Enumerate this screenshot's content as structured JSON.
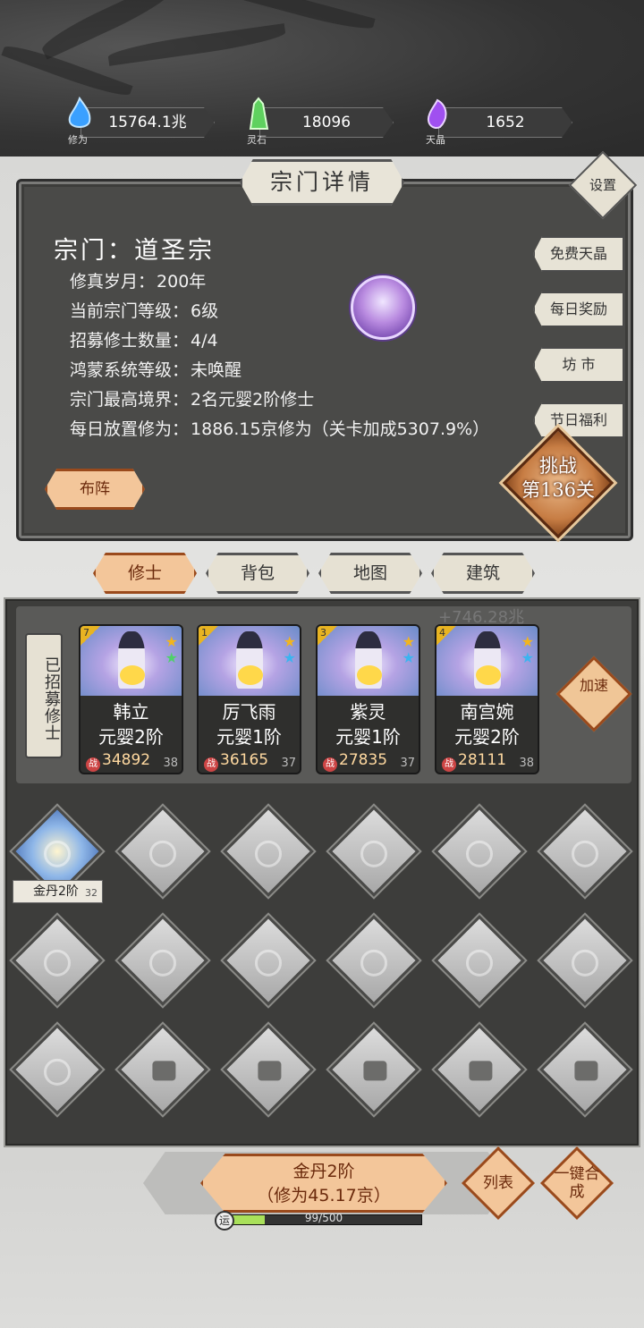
{
  "resources": [
    {
      "name": "修为",
      "value": "15764.1兆",
      "color": "#3aa0ff"
    },
    {
      "name": "灵石",
      "value": "18096",
      "color": "#5fd15f"
    },
    {
      "name": "天晶",
      "value": "1652",
      "color": "#a050f0"
    }
  ],
  "panel": {
    "title": "宗门详情",
    "settings": "设置",
    "sect_name": "宗门：道圣宗",
    "info": [
      {
        "label": "修真岁月：",
        "value": "200年"
      },
      {
        "label": "当前宗门等级：",
        "value": "6级"
      },
      {
        "label": "招募修士数量：",
        "value": "4/4"
      },
      {
        "label": "鸿蒙系统等级：",
        "value": "未唤醒"
      },
      {
        "label": "宗门最高境界：",
        "value": "2名元婴2阶修士"
      },
      {
        "label": "每日放置修为：",
        "value": "1886.15京修为（关卡加成5307.9%）"
      }
    ],
    "side_buttons": [
      "免费天晶",
      "每日奖励",
      "坊 市",
      "节日福利"
    ],
    "formation": "布阵",
    "challenge_line1": "挑战",
    "challenge_line2": "第136关"
  },
  "tabs": [
    {
      "label": "修士",
      "active": true
    },
    {
      "label": "背包",
      "active": false
    },
    {
      "label": "地图",
      "active": false
    },
    {
      "label": "建筑",
      "active": false
    }
  ],
  "gain_text": "+746.28兆",
  "recruited_label": "已招募修士",
  "cultivators": [
    {
      "rank": "7",
      "name": "韩立",
      "realm": "元婴2阶",
      "power": "34892",
      "level": "38",
      "stars": [
        "gold",
        "green"
      ]
    },
    {
      "rank": "1",
      "name": "厉飞雨",
      "realm": "元婴1阶",
      "power": "36165",
      "level": "37",
      "stars": [
        "gold",
        "blue"
      ]
    },
    {
      "rank": "3",
      "name": "紫灵",
      "realm": "元婴1阶",
      "power": "27835",
      "level": "37",
      "stars": [
        "gold",
        "blue"
      ]
    },
    {
      "rank": "4",
      "name": "南宫婉",
      "realm": "元婴2阶",
      "power": "28111",
      "level": "38",
      "stars": [
        "gold",
        "blue"
      ]
    }
  ],
  "power_badge": "战",
  "speed_up": "加速",
  "grid_item": {
    "realm": "金丹2阶",
    "level": "32"
  },
  "bottom": {
    "merge_line1": "金丹2阶",
    "merge_line2": "（修为45.17京）",
    "list": "列表",
    "one_click_merge": "一键合成",
    "luck_icon": "运",
    "luck_value": 99,
    "luck_max": 500,
    "luck_text": "99/500"
  }
}
